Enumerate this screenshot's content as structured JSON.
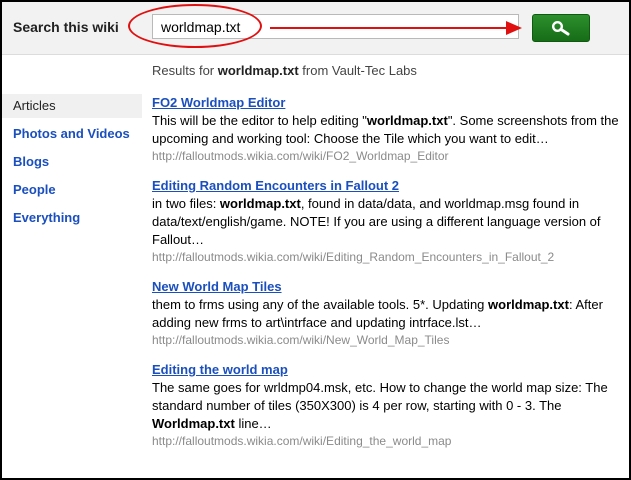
{
  "search": {
    "label": "Search this wiki",
    "query": "worldmap.txt",
    "button_icon": "magnifier-icon",
    "highlight_color": "#e01010"
  },
  "summary": {
    "prefix": "Results for ",
    "query": "worldmap.txt",
    "suffix": " from Vault-Tec Labs"
  },
  "sidebar": {
    "items": [
      {
        "label": "Articles",
        "active": true
      },
      {
        "label": "Photos and Videos"
      },
      {
        "label": "Blogs"
      },
      {
        "label": "People"
      },
      {
        "label": "Everything"
      }
    ]
  },
  "results": [
    {
      "title": "FO2 Worldmap Editor",
      "snippet": [
        {
          "t": "This will be the editor to help editing \""
        },
        {
          "t": "worldmap.txt",
          "b": true
        },
        {
          "t": "\". Some screenshots from the upcoming and working tool: Choose the Tile which you want to edit…"
        }
      ],
      "url": "http://falloutmods.wikia.com/wiki/FO2_Worldmap_Editor"
    },
    {
      "title": "Editing Random Encounters in Fallout 2",
      "snippet": [
        {
          "t": "in two files: "
        },
        {
          "t": "worldmap.txt",
          "b": true
        },
        {
          "t": ", found in data/data, and worldmap.msg found in data/text/english/game. NOTE! If you are using a different language version of Fallout…"
        }
      ],
      "url": "http://falloutmods.wikia.com/wiki/Editing_Random_Encounters_in_Fallout_2"
    },
    {
      "title": "New World Map Tiles",
      "snippet": [
        {
          "t": "them to frms using any of the available tools. 5*. Updating "
        },
        {
          "t": "worldmap.txt",
          "b": true
        },
        {
          "t": ": After adding new frms to art\\intrface and updating intrface.lst…"
        }
      ],
      "url": "http://falloutmods.wikia.com/wiki/New_World_Map_Tiles"
    },
    {
      "title": "Editing the world map",
      "snippet": [
        {
          "t": "The same goes for wrldmp04.msk, etc. How to change the world map size: The standard number of tiles (350X300) is 4 per row, starting with 0 - 3. The "
        },
        {
          "t": "Worldmap.txt",
          "b": true
        },
        {
          "t": " line…"
        }
      ],
      "url": "http://falloutmods.wikia.com/wiki/Editing_the_world_map"
    }
  ]
}
